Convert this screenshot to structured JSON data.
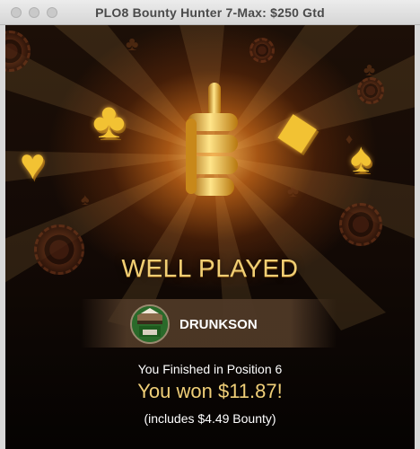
{
  "window": {
    "title": "PLO8 Bounty Hunter 7-Max: $250 Gtd"
  },
  "result": {
    "headline": "WELL PLAYED",
    "player_name": "DRUNKSON",
    "finish_text": "You Finished in Position 6",
    "won_text": "You won $11.87!",
    "bounty_text": "(includes $4.49 Bounty)"
  },
  "colors": {
    "gold": "#f1cf74",
    "background": "#0a0604",
    "band": "#4e3826"
  },
  "icons": [
    "club-icon",
    "heart-icon",
    "diamond-icon",
    "spade-icon",
    "trophy-icon",
    "poker-chip-icon"
  ]
}
